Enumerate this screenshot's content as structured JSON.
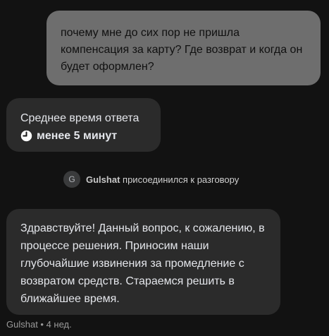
{
  "messages": {
    "user_question": "почему мне до сих пор не пришла компенсация за карту? Где возврат и когда он будет оформлен?",
    "response_time": {
      "label": "Среднее время ответа",
      "icon": "clock-icon",
      "value": "менее 5 минут"
    },
    "join_event": {
      "avatar_letter": "G",
      "agent_name": "Gulshat",
      "text": "присоединился к разговору"
    },
    "agent_reply": "Здравствуйте! Данный вопрос, к сожалению, в процессе решения. Приносим наши глубочайшие извинения за промедление с возвратом средств. Стараемся решить в ближайшее время.",
    "agent_meta": "Gulshat • 4 нед."
  },
  "colors": {
    "background": "#121212",
    "user_bubble": "#6e6e6e",
    "agent_bubble": "#2b2b2b"
  }
}
